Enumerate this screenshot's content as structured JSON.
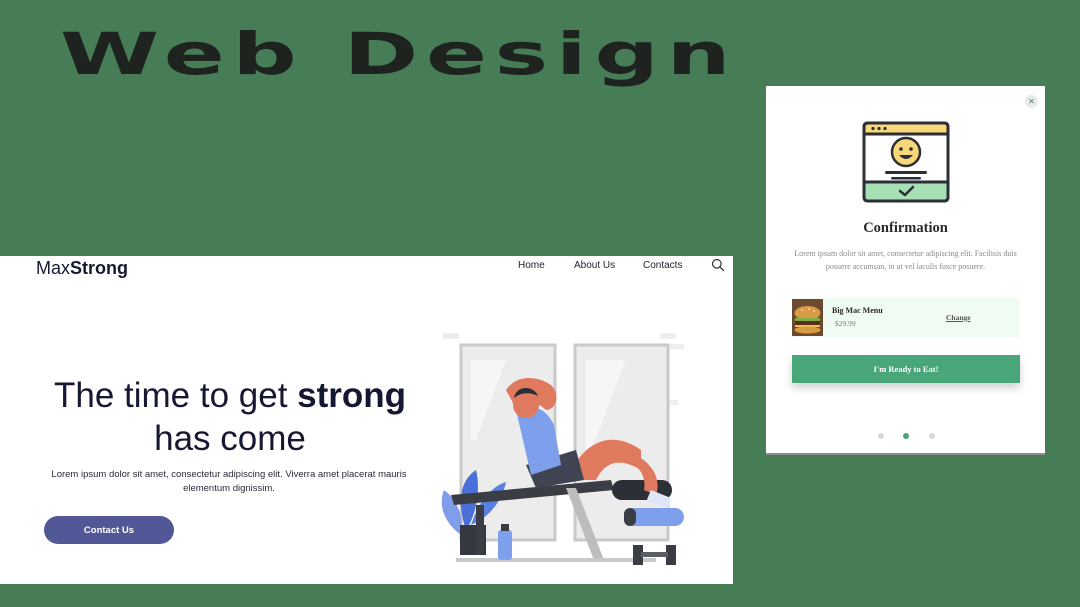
{
  "heading": "Web Design",
  "website": {
    "logo": {
      "regular": "Max",
      "bold": "Strong"
    },
    "nav": {
      "home": "Home",
      "about": "About Us",
      "contacts": "Contacts"
    },
    "search_icon": "search-icon",
    "hero": {
      "title_part1": "The time to get ",
      "title_bold": "strong",
      "title_part2": "has come",
      "text": "Lorem ipsum dolor sit amet, consectetur adipiscing elit. Viverra amet placerat mauris elementum dignissim.",
      "cta_label": "Contact Us"
    },
    "colors": {
      "accent": "#525797",
      "text": "#161833"
    }
  },
  "modal": {
    "title": "Confirmation",
    "text": "Lorem ipsum dolor sit amet, consectetur adipiscing elit. Facilisis duis posuere accumsan, in ut vel iaculis fusce posuere.",
    "close_icon": "close-icon",
    "order": {
      "name": "Big Mac Menu",
      "price": "$29.99",
      "change_label": "Change"
    },
    "button_label": "I'm Ready to Eat!",
    "pagination": {
      "total": 3,
      "active": 2
    },
    "colors": {
      "accent": "#48a679",
      "order_bg": "#f0fcf3"
    }
  },
  "background_color": "#467d56"
}
